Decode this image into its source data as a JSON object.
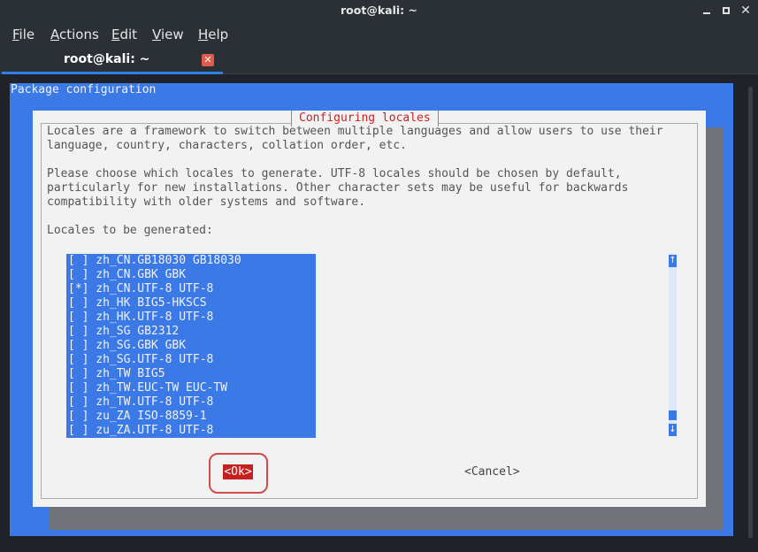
{
  "window": {
    "title": "root@kali: ~",
    "min": "",
    "max": "",
    "close": "✕"
  },
  "menu": [
    {
      "u": "F",
      "rest": "ile"
    },
    {
      "u": "A",
      "rest": "ctions"
    },
    {
      "u": "E",
      "rest": "dit"
    },
    {
      "u": "V",
      "rest": "iew"
    },
    {
      "u": "H",
      "rest": "elp"
    }
  ],
  "tab": {
    "label": "root@kali: ~",
    "close": "✕"
  },
  "backtitle": "Package configuration",
  "dialog": {
    "title": "Configuring locales",
    "desc_lines": [
      "Locales are a framework to switch between multiple languages and allow users to use their",
      "language, country, characters, collation order, etc.",
      "",
      "Please choose which locales to generate. UTF-8 locales should be chosen by default,",
      "particularly for new installations. Other character sets may be useful for backwards",
      "compatibility with older systems and software.",
      "",
      "Locales to be generated:"
    ],
    "locales": [
      {
        "mark": "[ ]",
        "name": "zh_CN.GB18030 GB18030"
      },
      {
        "mark": "[ ]",
        "name": "zh_CN.GBK GBK"
      },
      {
        "mark": "[*]",
        "name": "zh_CN.UTF-8 UTF-8"
      },
      {
        "mark": "[ ]",
        "name": "zh_HK BIG5-HKSCS"
      },
      {
        "mark": "[ ]",
        "name": "zh_HK.UTF-8 UTF-8"
      },
      {
        "mark": "[ ]",
        "name": "zh_SG GB2312"
      },
      {
        "mark": "[ ]",
        "name": "zh_SG.GBK GBK"
      },
      {
        "mark": "[ ]",
        "name": "zh_SG.UTF-8 UTF-8"
      },
      {
        "mark": "[ ]",
        "name": "zh_TW BIG5"
      },
      {
        "mark": "[ ]",
        "name": "zh_TW.EUC-TW EUC-TW"
      },
      {
        "mark": "[ ]",
        "name": "zh_TW.UTF-8 UTF-8"
      },
      {
        "mark": "[ ]",
        "name": "zu_ZA ISO-8859-1"
      },
      {
        "mark": "[ ]",
        "name": "zu_ZA.UTF-8 UTF-8"
      }
    ],
    "scroll_up": "↑",
    "scroll_down": "↓",
    "ok_label": "<Ok>",
    "cancel_label": "<Cancel>"
  },
  "colors": {
    "accent": "#3a79e6",
    "ok_button": "#c42020",
    "title_text": "#cc2222"
  },
  "icons": {
    "tab_close": "close-icon",
    "window_close": "close-icon",
    "scroll_up": "arrow-up-icon",
    "scroll_down": "arrow-down-icon"
  }
}
